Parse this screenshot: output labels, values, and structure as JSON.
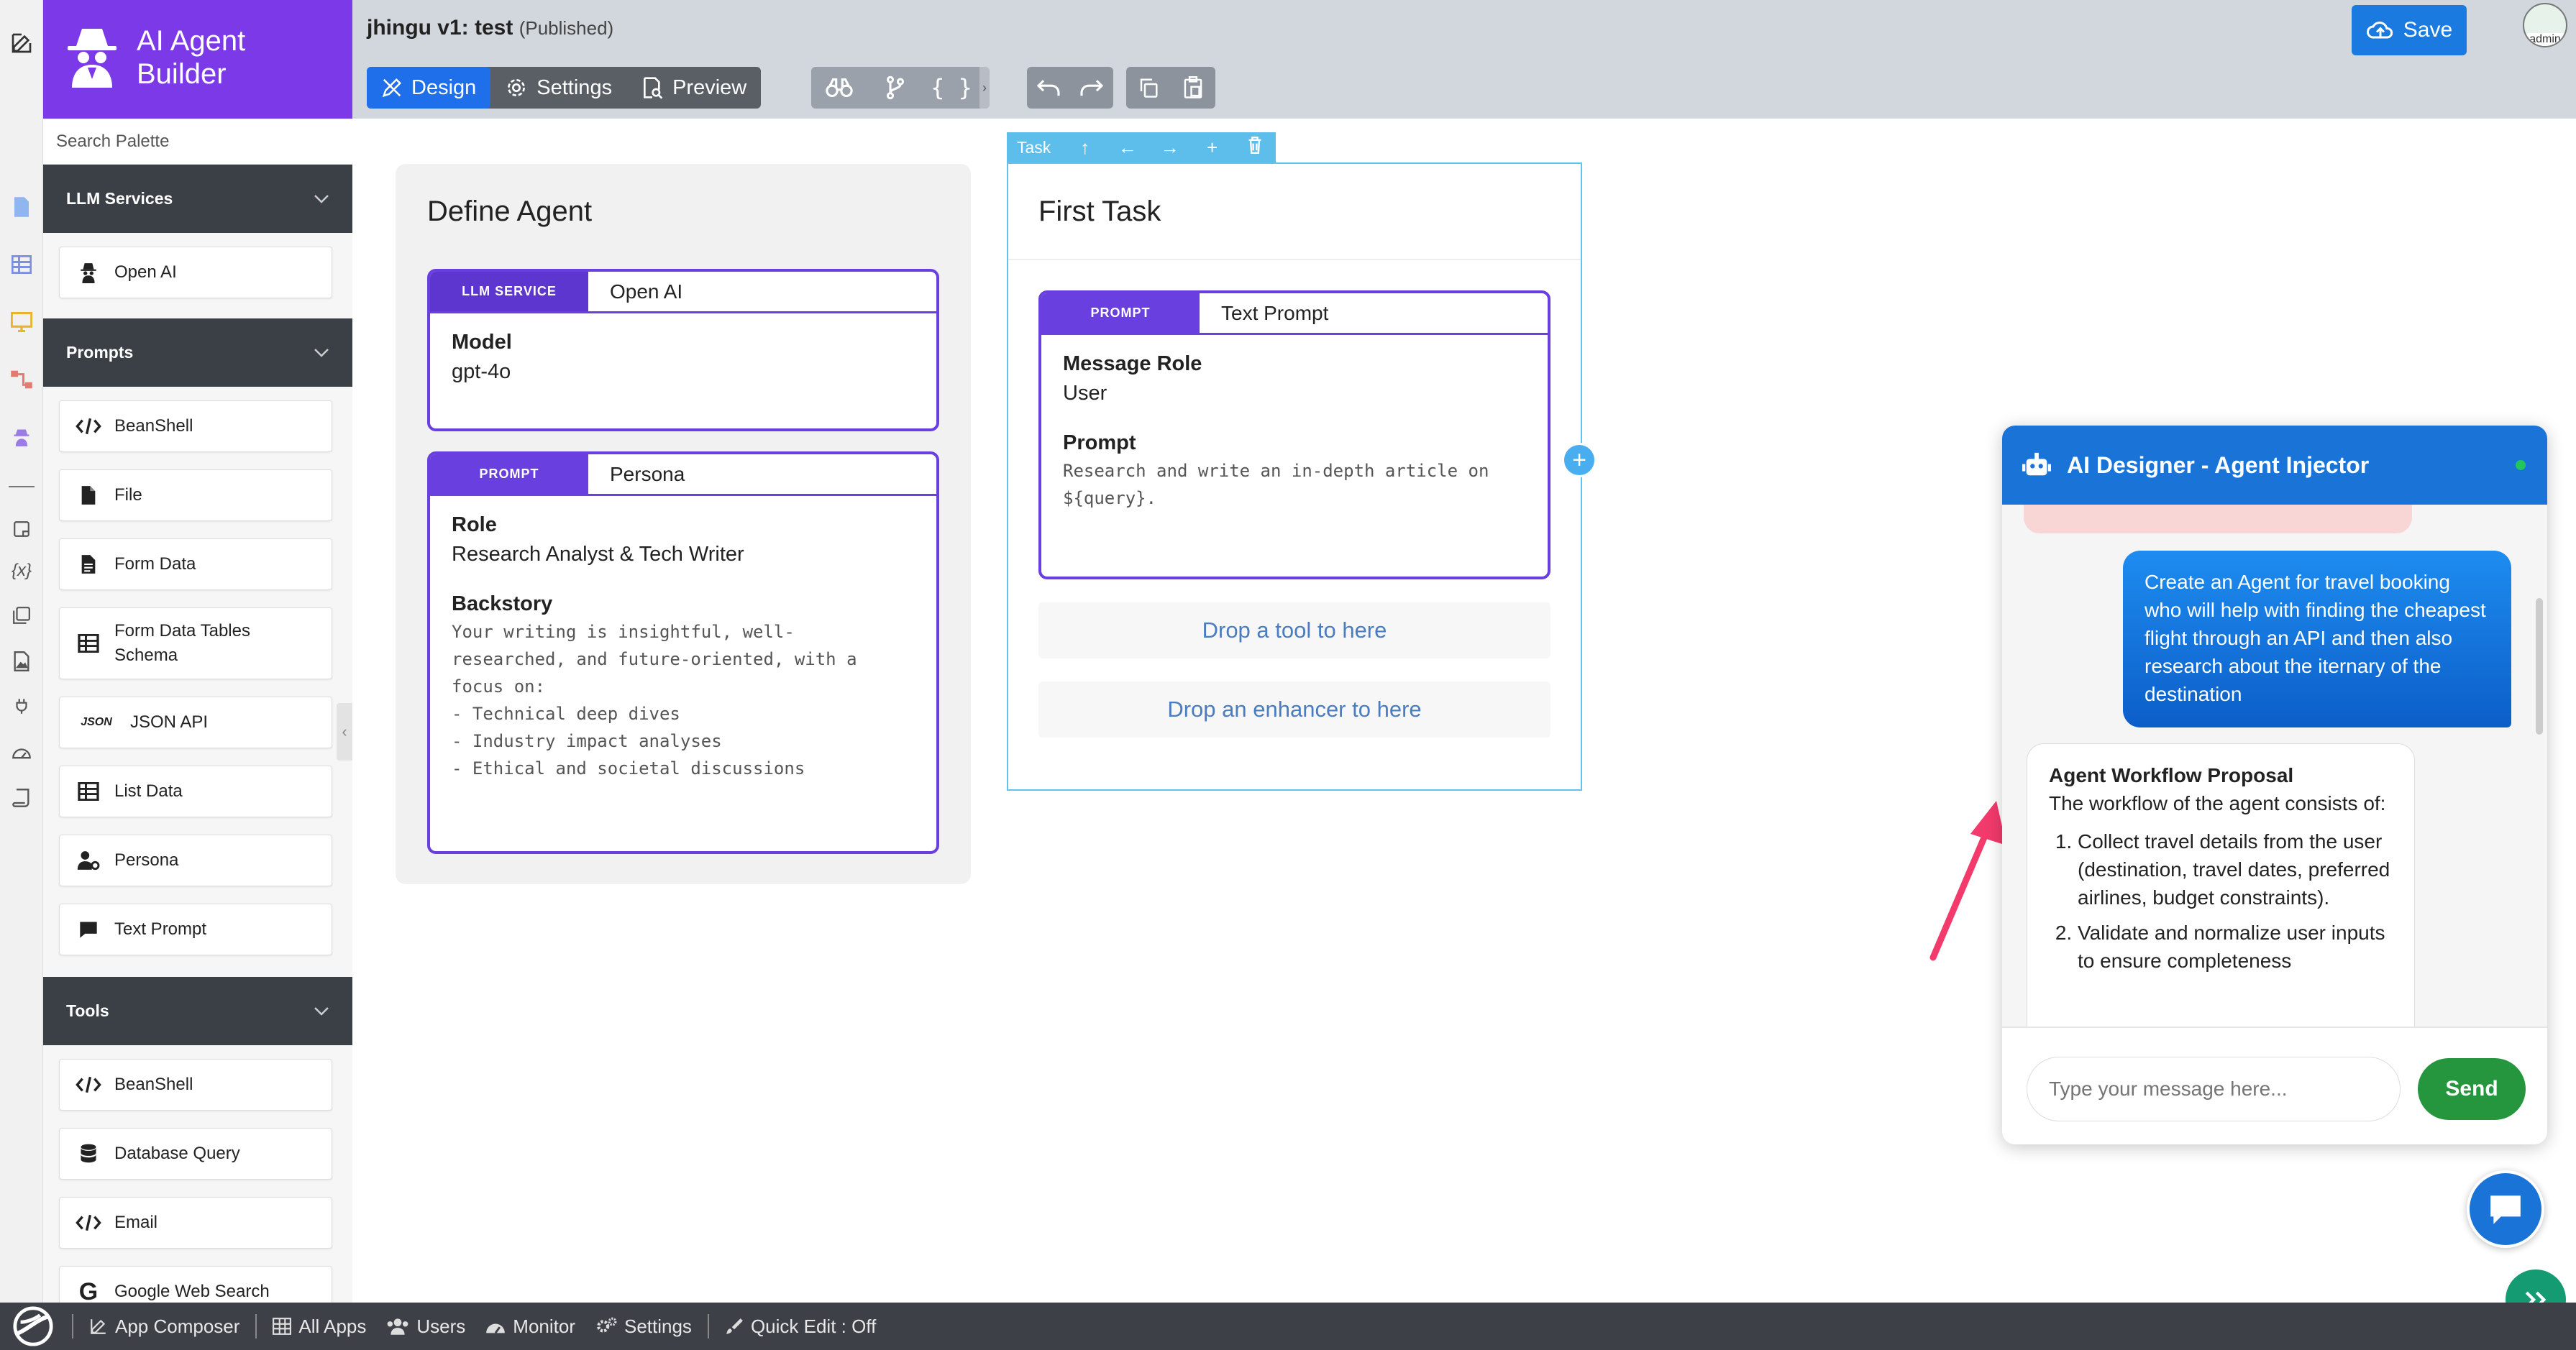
{
  "header": {
    "app_name": "jhingu v1: test",
    "status": "(Published)",
    "brand_title": "AI Agent Builder",
    "save_label": "Save",
    "avatar_label": "admin"
  },
  "toolbar": {
    "design": "Design",
    "settings": "Settings",
    "preview": "Preview"
  },
  "palette": {
    "search_placeholder": "Search Palette",
    "sections": [
      {
        "title": "LLM Services",
        "items": [
          "Open AI"
        ]
      },
      {
        "title": "Prompts",
        "items": [
          "BeanShell",
          "File",
          "Form Data",
          "Form Data Tables Schema",
          "JSON API",
          "List Data",
          "Persona",
          "Text Prompt"
        ]
      },
      {
        "title": "Tools",
        "items": [
          "BeanShell",
          "Database Query",
          "Email",
          "Google Web Search"
        ]
      }
    ],
    "json_badge": "JSON"
  },
  "agent_card": {
    "title": "Define Agent",
    "llm": {
      "tag": "LLM SERVICE",
      "name": "Open AI",
      "model_label": "Model",
      "model_value": "gpt-4o"
    },
    "persona": {
      "tag": "PROMPT",
      "name": "Persona",
      "role_label": "Role",
      "role_value": "Research Analyst & Tech Writer",
      "backstory_label": "Backstory",
      "backstory_value": "Your writing is insightful, well-\nresearched, and future-oriented, with a\nfocus on:\n- Technical deep dives\n- Industry impact analyses\n- Ethical and societal discussions"
    }
  },
  "task_card": {
    "bar_label": "Task",
    "title": "First Task",
    "prompt": {
      "tag": "PROMPT",
      "name": "Text Prompt",
      "role_label": "Message Role",
      "role_value": "User",
      "prompt_label": "Prompt",
      "prompt_value": "Research and write an in-depth article on\n${query}."
    },
    "drop_tool": "Drop a tool to here",
    "drop_enhancer": "Drop an enhancer to here"
  },
  "chat": {
    "title": "AI Designer - Agent Injector",
    "user_message": "Create an Agent for travel booking who will help with finding the cheapest flight through an API and then also research about the iternary of the destination",
    "bot_title": "Agent Workflow Proposal",
    "bot_intro": "The workflow of the agent consists of:",
    "bot_steps": [
      "Collect travel details from the user (destination, travel dates, preferred airlines, budget constraints).",
      "Validate and normalize user inputs to ensure completeness"
    ],
    "input_placeholder": "Type your message here...",
    "send_label": "Send"
  },
  "bottombar": {
    "app_composer": "App Composer",
    "all_apps": "All Apps",
    "users": "Users",
    "monitor": "Monitor",
    "settings": "Settings",
    "quick_edit": "Quick Edit : Off"
  },
  "colors": {
    "brand": "#7b39e8",
    "accent": "#1a74d8",
    "prompt_border": "#6a3fe0",
    "send": "#25963e",
    "annotation_arrow": "#f23a6c"
  }
}
